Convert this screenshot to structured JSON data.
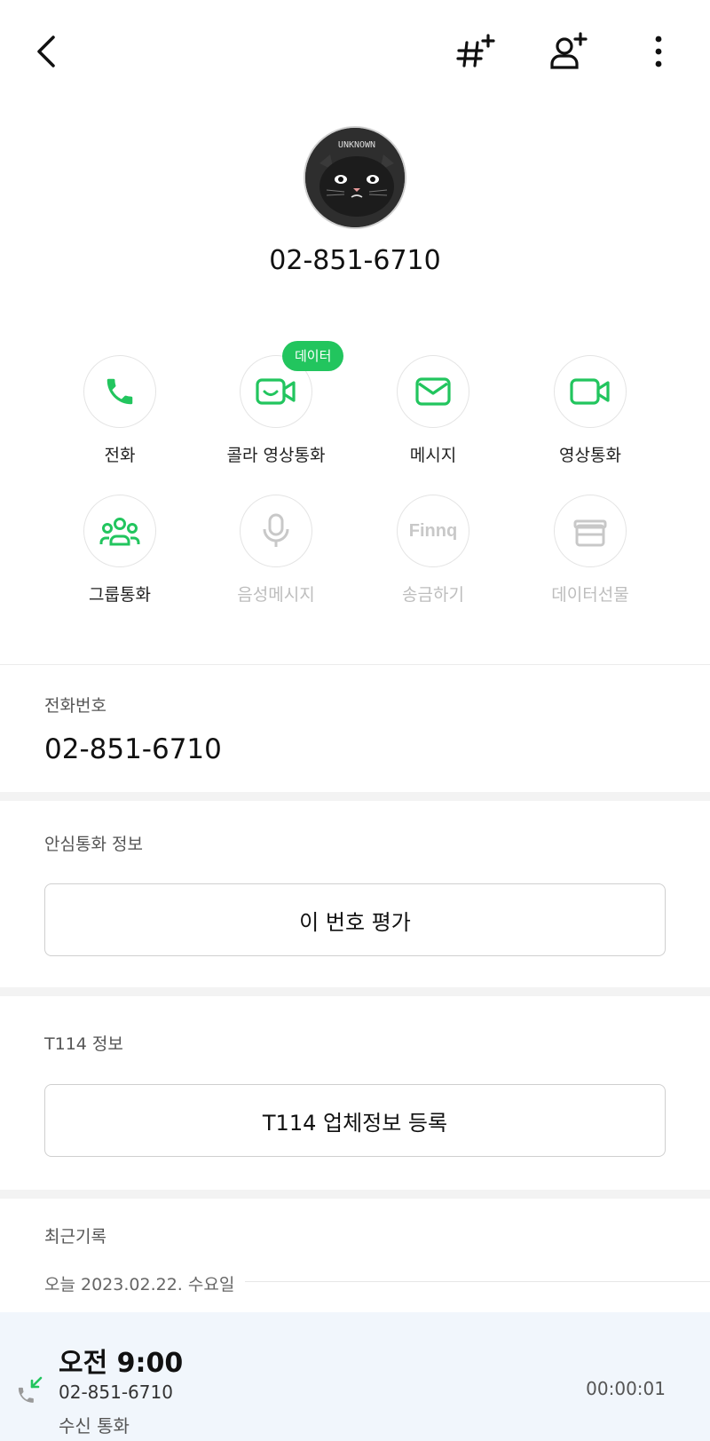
{
  "header": {
    "back_icon": "chevron-left-icon",
    "actions": [
      {
        "icon": "hashtag-plus-icon"
      },
      {
        "icon": "person-add-icon"
      },
      {
        "icon": "more-vertical-icon"
      }
    ]
  },
  "profile": {
    "avatar_text": "UNKNOWN",
    "number": "02-851-6710"
  },
  "quick_actions": {
    "row1": [
      {
        "label": "전화",
        "icon": "phone-icon"
      },
      {
        "label": "콜라 영상통화",
        "icon": "video-smile-icon",
        "badge": "데이터"
      },
      {
        "label": "메시지",
        "icon": "mail-icon"
      },
      {
        "label": "영상통화",
        "icon": "video-icon"
      }
    ],
    "row2": [
      {
        "label": "그룹통화",
        "icon": "group-icon"
      },
      {
        "label": "음성메시지",
        "icon": "mic-icon"
      },
      {
        "label": "송금하기",
        "icon": "finnq-icon",
        "icon_text": "Finnq"
      },
      {
        "label": "데이터선물",
        "icon": "gift-icon"
      }
    ]
  },
  "phone_section": {
    "label": "전화번호",
    "value": "02-851-6710"
  },
  "safe_call_section": {
    "label": "안심통화 정보",
    "button": "이 번호 평가"
  },
  "t114_section": {
    "label": "T114 정보",
    "button": "T114 업체정보 등록"
  },
  "recent_section": {
    "label": "최근기록",
    "date": "오늘 2023.02.22. 수요일",
    "call": {
      "time": "오전 9:00",
      "number": "02-851-6710",
      "type": "수신 통화",
      "duration": "00:00:01",
      "icon": "incoming-call-icon"
    }
  },
  "colors": {
    "accent": "#22c55e",
    "disabled": "#bdbdbd",
    "call_card_bg": "#f1f6fc"
  }
}
